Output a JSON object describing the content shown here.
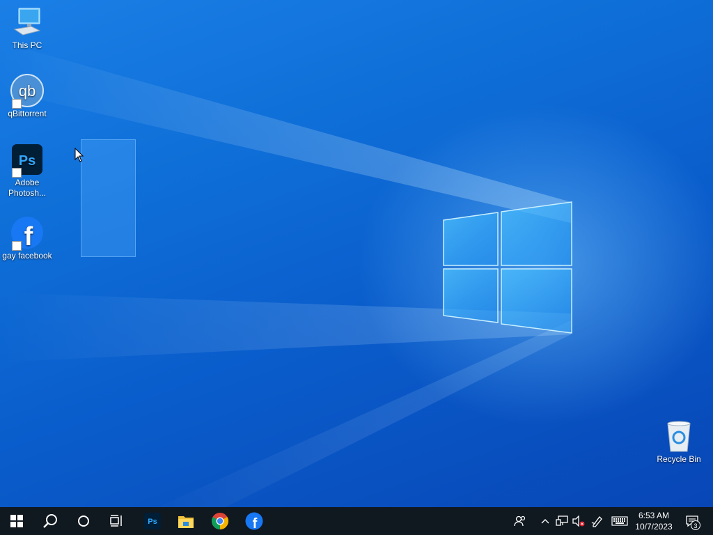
{
  "desktop": {
    "icons": [
      {
        "label": "This PC"
      },
      {
        "label": "qBittorrent",
        "glyph": "qb"
      },
      {
        "label": "Adobe Photosh...",
        "glyph": "Ps"
      },
      {
        "label": "gay facebook",
        "glyph": "f"
      },
      {
        "label": "Recycle Bin"
      }
    ]
  },
  "taskbar": {
    "start_icon": "windows-logo-icon",
    "search_icon": "search-icon",
    "cortana_icon": "cortana-circle-icon",
    "task_view_icon": "task-view-icon",
    "pinned_apps": [
      {
        "name": "photoshop-icon",
        "glyph": "Ps"
      },
      {
        "name": "file-explorer-icon"
      },
      {
        "name": "chrome-icon"
      },
      {
        "name": "facebook-icon",
        "glyph": "f"
      }
    ],
    "tray": {
      "people_icon": "people-icon",
      "overflow_icon": "chevron-up-icon",
      "network_icon": "network-icon",
      "volume_icon": "volume-muted-icon",
      "pen_icon": "pen-workspace-icon",
      "keyboard_icon": "touch-keyboard-icon"
    },
    "clock": {
      "time": "6:53 AM",
      "date": "10/7/2023"
    },
    "notifications": {
      "count": "3"
    }
  },
  "colors": {
    "taskbar": "#101820",
    "accent": "#0a6fd8",
    "facebook": "#1877f2",
    "photoshop": "#001e36"
  }
}
